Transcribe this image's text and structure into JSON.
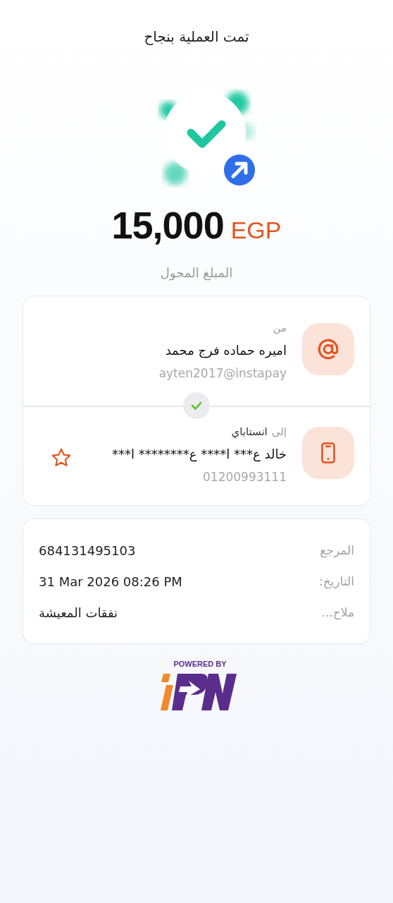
{
  "title": "تمت العملية بنجاح",
  "amount": {
    "value": "15,000",
    "currency": "EGP",
    "label": "المبلغ المحول"
  },
  "sender": {
    "label": "من",
    "name": "اميره حماده فرج محمد",
    "handle": "ayten2017@instapay"
  },
  "transfer_check": {
    "done": true
  },
  "receiver": {
    "label": "إلى",
    "bank": "انستاباي",
    "name": "خالد ع*** ا**** ع******** ا***",
    "phone": "01200993111",
    "favorite": false
  },
  "details": [
    {
      "label": "المرجع",
      "value": "684131495103"
    },
    {
      "label": "التاريخ:",
      "value": "31 Mar 2026 08:26 PM"
    },
    {
      "label": "ملاح...",
      "value": "نفقات المعيشة"
    }
  ],
  "footer": {
    "powered_by": "POWERED BY"
  }
}
